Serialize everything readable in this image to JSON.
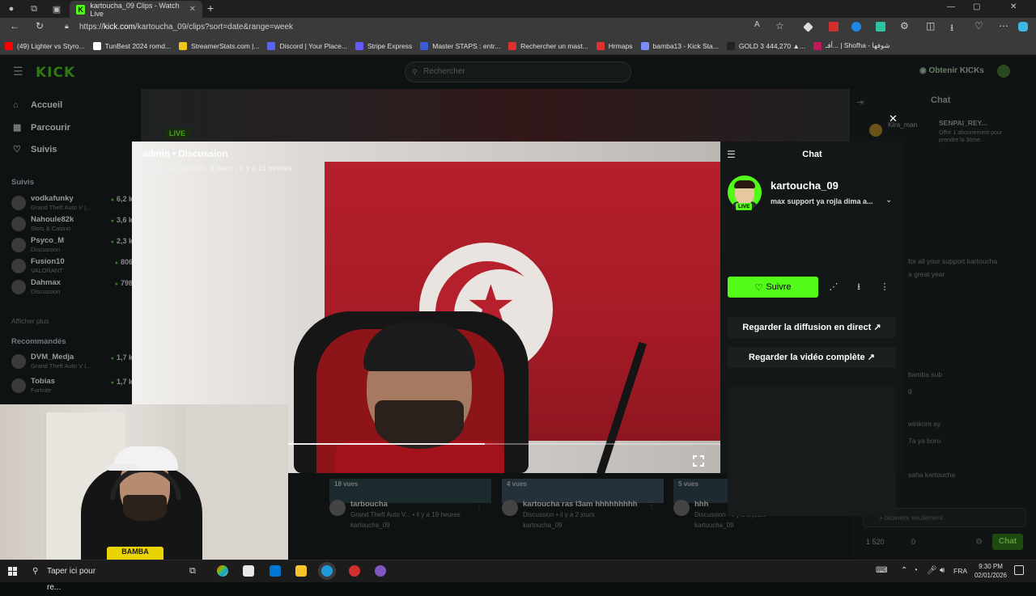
{
  "browser": {
    "tab_title": "kartoucha_09 Clips - Watch Live",
    "url_prefix": "https://",
    "url_domain": "kick.com",
    "url_path": "/kartoucha_09/clips?sort=date&range=week",
    "bookmarks": [
      {
        "label": "(49) Lighter vs Styro...",
        "color": "#ff0000"
      },
      {
        "label": "TunBest 2024 romd...",
        "color": "#ffffff"
      },
      {
        "label": "StreamerStats.com |...",
        "color": "#f0c419"
      },
      {
        "label": "Discord | Your Place...",
        "color": "#5865f2"
      },
      {
        "label": "Stripe Express",
        "color": "#635bff"
      },
      {
        "label": "Master STAPS : entr...",
        "color": "#3b5bdb"
      },
      {
        "label": "Rechercher un mast...",
        "color": "#e03131"
      },
      {
        "label": "Hrmaps",
        "color": "#e03131"
      },
      {
        "label": "bamba13 - Kick Sta...",
        "color": "#7c8cf8"
      },
      {
        "label": "GOLD 3 444,270 ▲...",
        "color": "#222222"
      },
      {
        "label": "أفـ... | Shofha - شوفها",
        "color": "#c2185b"
      }
    ]
  },
  "kick": {
    "logo": "KICK",
    "search_placeholder": "Rechercher",
    "get_kicks": "Obtenir KICKs",
    "nav": [
      {
        "label": "Accueil",
        "icon": "home-icon"
      },
      {
        "label": "Parcourir",
        "icon": "browse-icon"
      },
      {
        "label": "Suivis",
        "icon": "heart-icon"
      }
    ],
    "followed_title": "Suivis",
    "followed": [
      {
        "name": "vodkafunky",
        "game": "Grand Theft Auto V (...",
        "viewers": "6,2 k"
      },
      {
        "name": "Nahoule82k",
        "game": "Slots & Casino",
        "viewers": "3,6 k"
      },
      {
        "name": "Psyco_M",
        "game": "Discussion",
        "viewers": "2,3 k"
      },
      {
        "name": "Fusion10",
        "game": "VALORANT",
        "viewers": "806"
      },
      {
        "name": "Dahmax",
        "game": "Discussion",
        "viewers": "798"
      }
    ],
    "show_more": "Afficher plus",
    "recommended_title": "Recommandés",
    "recommended": [
      {
        "name": "DVM_Medja",
        "game": "Grand Theft Auto V (...",
        "viewers": "1,7 k"
      },
      {
        "name": "Tobias",
        "game": "Fortnite",
        "viewers": "1,7 k"
      }
    ],
    "bg_live": "LIVE",
    "bg_chat_title": "Chat",
    "bg_chat_input": "Followers seulement",
    "bg_chat_button": "Chat",
    "bg_count_1": "1 520",
    "bg_count_2": "0",
    "bg_chat_messages": [
      "for all your support kartoucha",
      "a great year",
      "bamba sub",
      "g",
      "winkom ay",
      "7a ya boro",
      "saha kartoucha"
    ],
    "bg_sub_user": "Kira_man",
    "bg_sub_gifter": "SENPAI_REY...",
    "bg_sub_text": "Offrir 1 abonnement pour prendre la 3ème.",
    "clips": [
      {
        "views": "18 vues",
        "title": "tarboucha",
        "meta": "Grand Theft Auto V... • il y a 19 heures",
        "channel": "kartoucha_09"
      },
      {
        "views": "4 vues",
        "title": "kartoucha ras l3am hhhhhhhhh",
        "meta": "Discussion • il y a 2 jours",
        "channel": "kartoucha_09"
      },
      {
        "views": "5 vues",
        "title": "hhh",
        "meta": "Discussion • il y a 2 jours",
        "channel": "kartoucha_09"
      }
    ]
  },
  "clip_modal": {
    "title": "admin • Discussion",
    "subtitle": "Clippé par Echriff • 9 Vues • il y a 19 heures",
    "progress": 0.6,
    "panel_title": "Chat",
    "channel": "kartoucha_09",
    "live_badge": "LIVE",
    "stream_title": "max support ya rojla dima a...",
    "follow_label": "Suivre",
    "watch_live": "Regarder la diffusion en direct",
    "watch_full": "Regarder la vidéo complète"
  },
  "webcam": {
    "logo_text": "BAMBA"
  },
  "taskbar": {
    "search_placeholder": "Taper ici pour re...",
    "lang": "FRA",
    "time": "9:30 PM",
    "date": "02/01/2026"
  },
  "colors": {
    "kick_green": "#53fc18",
    "flag_red": "#b61f2c",
    "panel_bg": "#141718"
  }
}
